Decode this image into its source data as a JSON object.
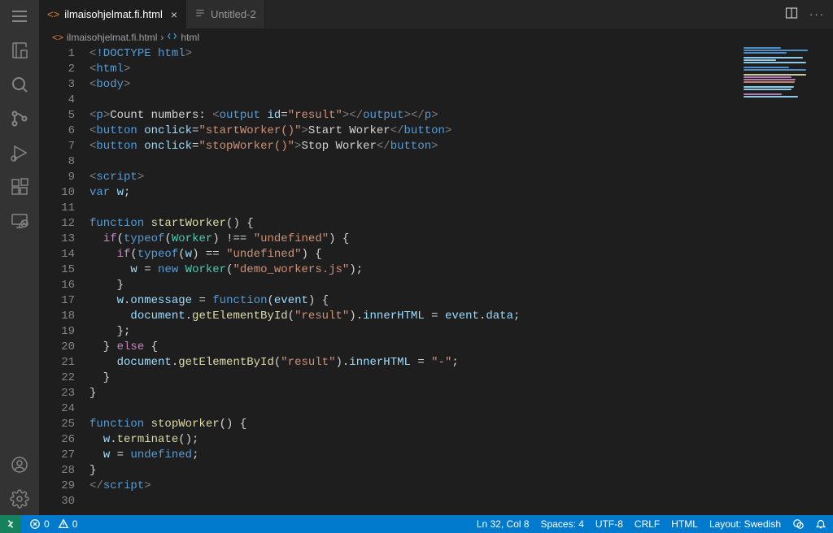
{
  "tabs": [
    {
      "label": "ilmaisohjelmat.fi.html",
      "active": true,
      "iconColor": "orange"
    },
    {
      "label": "Untitled-2",
      "active": false,
      "iconColor": "gray"
    }
  ],
  "breadcrumbs": {
    "file": "ilmaisohjelmat.fi.html",
    "symbol": "html"
  },
  "code_lines": [
    "<!DOCTYPE html>",
    "<html>",
    "<body>",
    "",
    "<p>Count numbers: <output id=\"result\"></output></p>",
    "<button onclick=\"startWorker()\">Start Worker</button>",
    "<button onclick=\"stopWorker()\">Stop Worker</button>",
    "",
    "<script>",
    "var w;",
    "",
    "function startWorker() {",
    "  if(typeof(Worker) !== \"undefined\") {",
    "    if(typeof(w) == \"undefined\") {",
    "      w = new Worker(\"demo_workers.js\");",
    "    }",
    "    w.onmessage = function(event) {",
    "      document.getElementById(\"result\").innerHTML = event.data;",
    "    };",
    "  } else {",
    "    document.getElementById(\"result\").innerHTML = \"-\";",
    "  }",
    "}",
    "",
    "function stopWorker() {",
    "  w.terminate();",
    "  w = undefined;",
    "}",
    "</script>",
    ""
  ],
  "statusbar": {
    "errors": "0",
    "warnings": "0",
    "cursor": "Ln 32, Col 8",
    "spaces": "Spaces: 4",
    "encoding": "UTF-8",
    "eol": "CRLF",
    "language": "HTML",
    "layout": "Layout: Swedish"
  }
}
